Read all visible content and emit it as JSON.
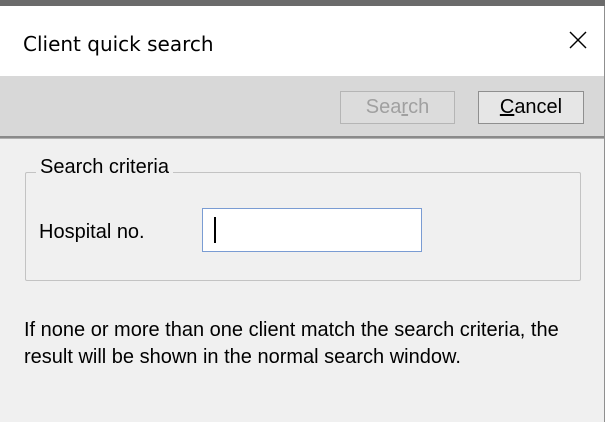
{
  "dialog": {
    "title": "Client quick search",
    "close_icon": "close-icon"
  },
  "toolbar": {
    "search_label": "Search",
    "search_mnemonic": "r",
    "search_enabled": false,
    "cancel_label": "Cancel",
    "cancel_mnemonic": "C"
  },
  "criteria": {
    "group_title": "Search criteria",
    "hospital_no_label": "Hospital no.",
    "hospital_no_value": ""
  },
  "info_text": "If none or more than one client match the search criteria, the result will be shown in the normal search window.",
  "colors": {
    "title_bg": "#ffffff",
    "toolbar_bg": "#d8d8d8",
    "body_bg": "#f0f0f0",
    "disabled_text": "#a0a0a0",
    "input_border": "#7a9cd3"
  }
}
